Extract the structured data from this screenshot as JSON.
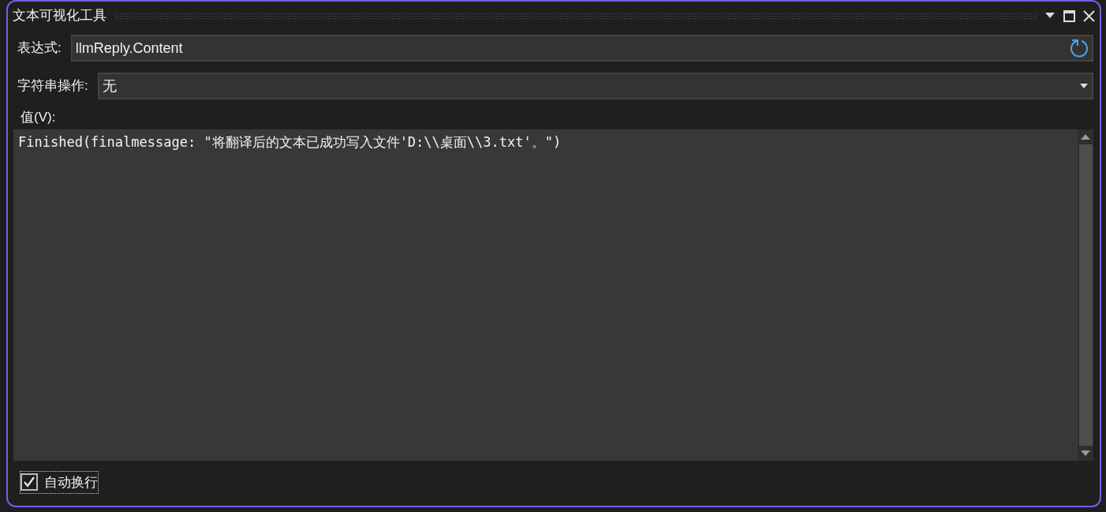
{
  "window": {
    "title": "文本可视化工具"
  },
  "expression": {
    "label": "表达式:",
    "value": "llmReply.Content"
  },
  "string_operation": {
    "label": "字符串操作:",
    "value": "无"
  },
  "value": {
    "label": "值(V):",
    "text": "Finished(finalmessage: \"将翻译后的文本已成功写入文件'D:\\\\桌面\\\\3.txt'。\")"
  },
  "word_wrap": {
    "label": "自动换行",
    "checked": true
  }
}
